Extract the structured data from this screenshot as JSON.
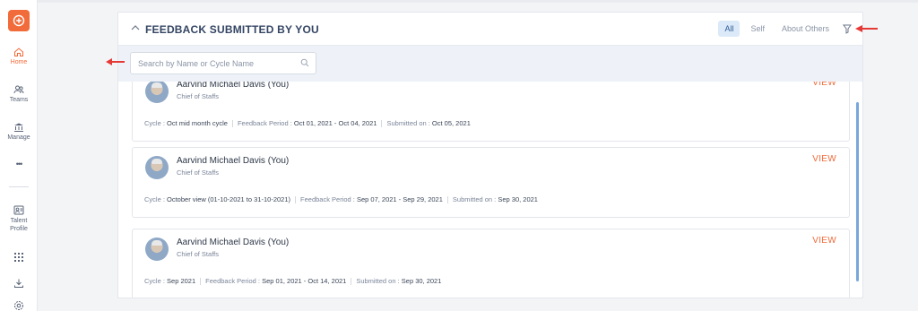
{
  "sidebar": {
    "items": [
      {
        "label": "Home",
        "icon": "home-icon"
      },
      {
        "label": "Teams",
        "icon": "teams-icon"
      },
      {
        "label": "Manage",
        "icon": "manage-icon"
      },
      {
        "label": "•••",
        "icon": "more-icon"
      },
      {
        "label": "Talent Profile",
        "icon": "talent-profile-icon"
      }
    ]
  },
  "panel": {
    "title": "FEEDBACK SUBMITTED BY YOU",
    "filters": [
      "All",
      "Self",
      "About Others"
    ],
    "active_filter": "All"
  },
  "search": {
    "placeholder": "Search by Name or Cycle Name",
    "value": ""
  },
  "labels": {
    "cycle": "Cycle : ",
    "feedback_period": "Feedback Period : ",
    "submitted_on": "Submitted on : ",
    "view": "VIEW"
  },
  "cards": [
    {
      "name": "Aarvind Michael Davis (You)",
      "role": "Chief of Staffs",
      "cycle": "Oct mid month cycle",
      "period": "Oct 01, 2021 - Oct 04, 2021",
      "submitted": "Oct 05, 2021"
    },
    {
      "name": "Aarvind Michael Davis (You)",
      "role": "Chief of Staffs",
      "cycle": "October view (01-10-2021 to 31-10-2021)",
      "period": "Sep 07, 2021 - Sep 29, 2021",
      "submitted": "Sep 30, 2021"
    },
    {
      "name": "Aarvind Michael Davis (You)",
      "role": "Chief of Staffs",
      "cycle": "Sep 2021",
      "period": "Sep 01, 2021 - Oct 14, 2021",
      "submitted": "Sep 30, 2021"
    }
  ],
  "colors": {
    "accent": "#f26b3a",
    "active_filter_bg": "#dbe9f8",
    "annotation_arrow": "#e53935"
  }
}
